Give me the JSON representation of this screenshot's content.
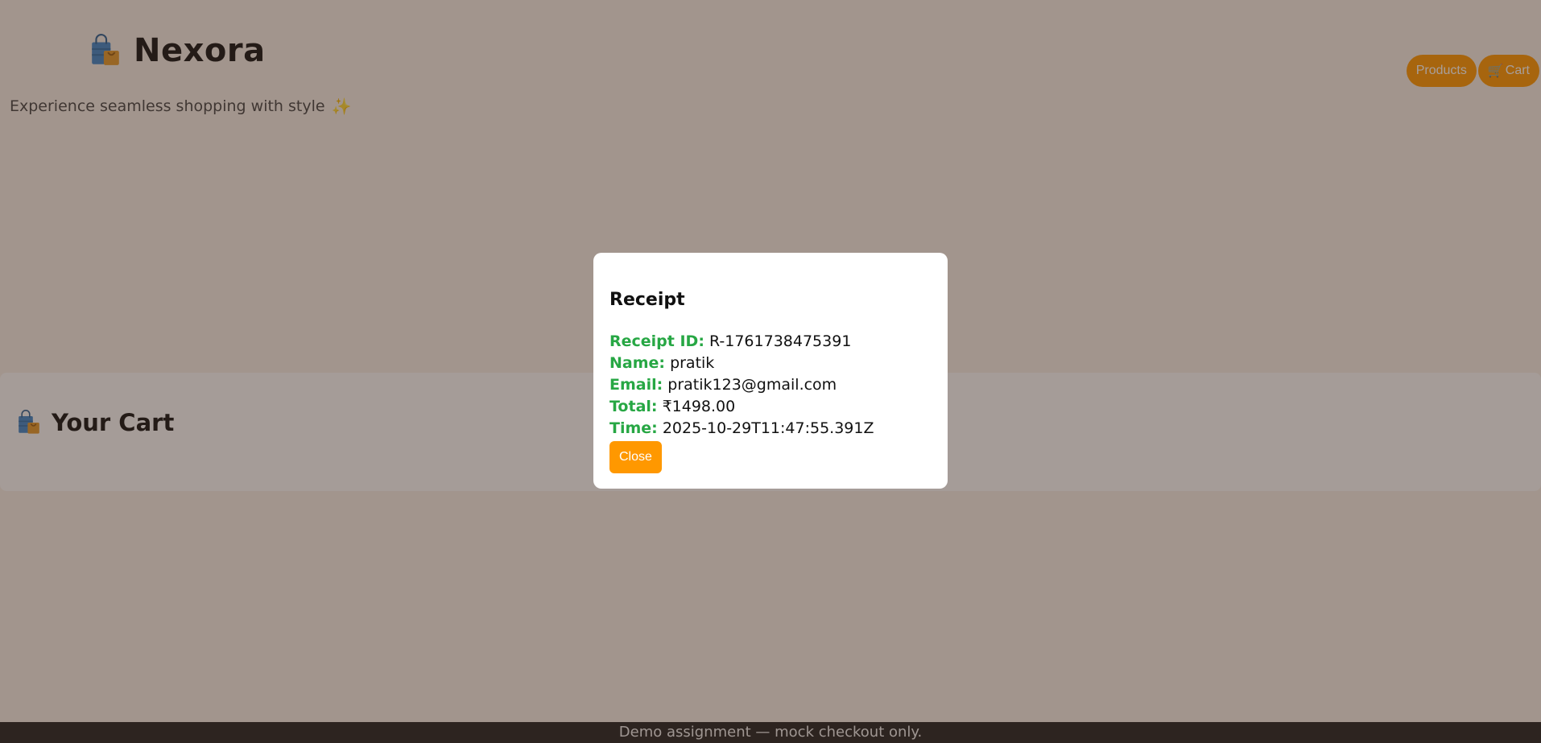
{
  "header": {
    "brand_name": "Nexora",
    "brand_icon": "shopping-bags-icon",
    "tagline": "Experience seamless shopping with style",
    "tagline_icon": "sparkles-icon",
    "nav": {
      "products_label": "Products",
      "cart_label": "Cart",
      "cart_icon": "shopping-cart-icon"
    }
  },
  "cart_section": {
    "title": "Your Cart",
    "icon": "shopping-bags-icon"
  },
  "receipt_modal": {
    "title": "Receipt",
    "rows": [
      {
        "label": "Receipt ID:",
        "value": "R-1761738475391"
      },
      {
        "label": "Name:",
        "value": "pratik"
      },
      {
        "label": "Email:",
        "value": "pratik123@gmail.com"
      },
      {
        "label": "Total:",
        "value": "₹1498.00"
      },
      {
        "label": "Time:",
        "value": "2025-10-29T11:47:55.391Z"
      }
    ],
    "close_label": "Close"
  },
  "footer": {
    "text": "Demo assignment — mock checkout only."
  },
  "colors": {
    "accent": "#ff9800",
    "label_green": "#27a744",
    "footer_bg": "#222222",
    "overlay": "rgba(60,40,30,0.45)"
  }
}
